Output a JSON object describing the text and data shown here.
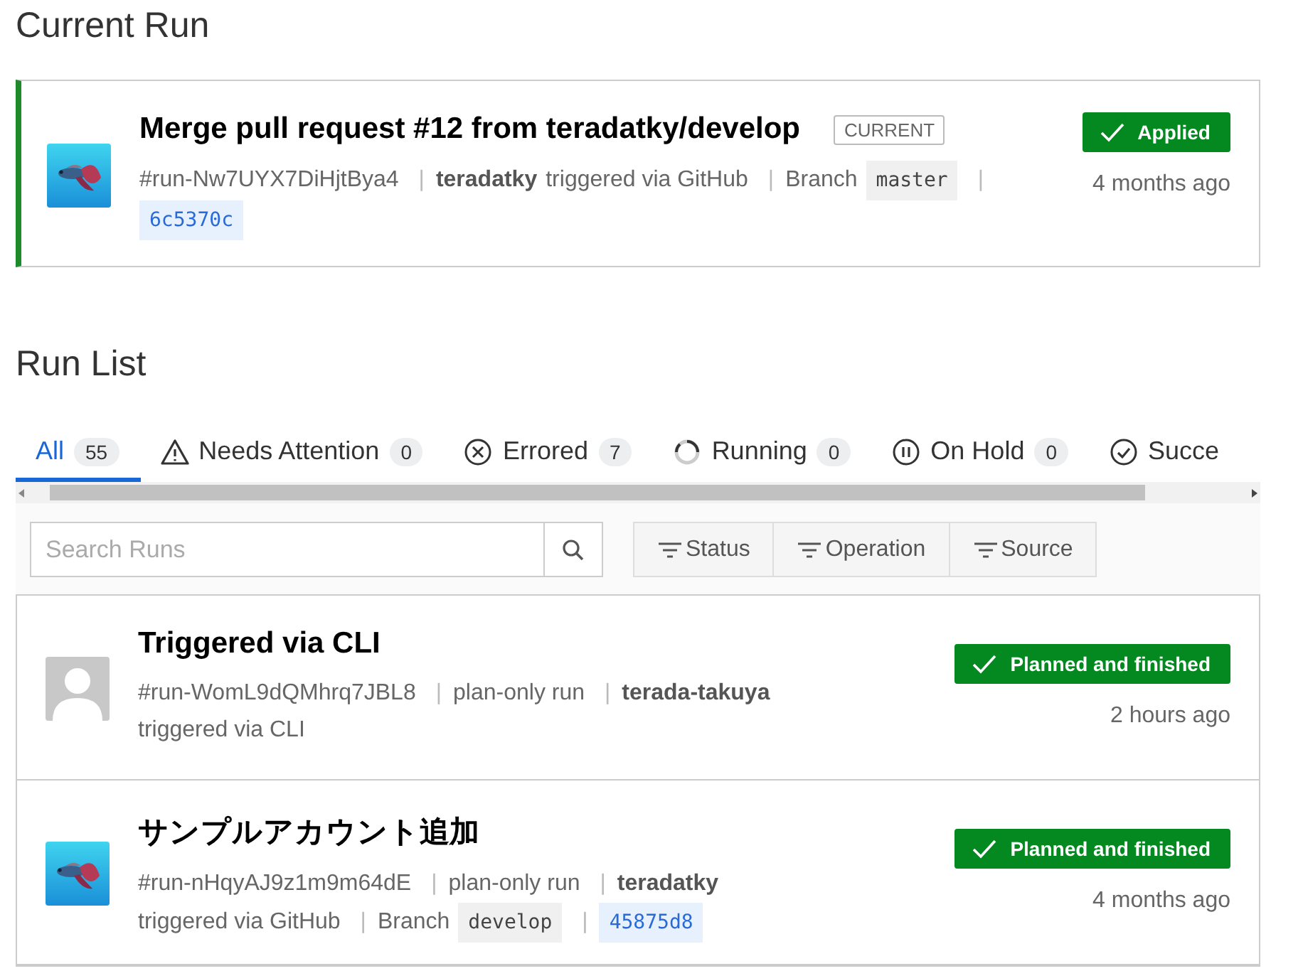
{
  "current_section": {
    "heading": "Current Run"
  },
  "current_run": {
    "title": "Merge pull request #12 from teradatky/develop",
    "tag": "CURRENT",
    "kind": "picture",
    "status": "Applied",
    "time": "4 months ago",
    "meta": [
      {
        "kind": "id",
        "text": "#run-Nw7UYX7DiHjtBya4"
      },
      {
        "kind": "sep",
        "text": "|"
      },
      {
        "kind": "user",
        "text": "teradatky"
      },
      {
        "kind": "text",
        "text": "triggered via GitHub"
      },
      {
        "kind": "sep",
        "text": "|"
      },
      {
        "kind": "text",
        "text": "Branch"
      },
      {
        "kind": "branch",
        "text": "master"
      },
      {
        "kind": "sep",
        "text": "|"
      },
      {
        "kind": "commit",
        "text": "6c5370c"
      }
    ]
  },
  "run_list_section": {
    "heading": "Run List"
  },
  "tabs": [
    {
      "label": "All",
      "count": "55",
      "kind": "plain",
      "selected": true
    },
    {
      "label": "Needs Attention",
      "count": "0",
      "kind": "warning",
      "selected": false
    },
    {
      "label": "Errored",
      "count": "7",
      "kind": "error",
      "selected": false
    },
    {
      "label": "Running",
      "count": "0",
      "kind": "running",
      "selected": false
    },
    {
      "label": "On Hold",
      "count": "0",
      "kind": "pause",
      "selected": false
    },
    {
      "label": "Succe",
      "kind": "check",
      "selected": false
    }
  ],
  "search": {
    "placeholder": "Search Runs"
  },
  "filters": [
    "Status",
    "Operation",
    "Source"
  ],
  "runs": [
    {
      "title": "Triggered via CLI",
      "kind": "default",
      "status": "Planned and finished",
      "time": "2 hours ago",
      "meta": [
        {
          "kind": "id",
          "text": "#run-WomL9dQMhrq7JBL8"
        },
        {
          "kind": "sep",
          "text": "|"
        },
        {
          "kind": "text",
          "text": "plan-only run"
        },
        {
          "kind": "sep",
          "text": "|"
        },
        {
          "kind": "user",
          "text": "terada-takuya"
        },
        {
          "kind": "text",
          "text": "triggered via CLI"
        }
      ]
    },
    {
      "title": "サンプルアカウント追加",
      "kind": "picture",
      "status": "Planned and finished",
      "time": "4 months ago",
      "meta": [
        {
          "kind": "id",
          "text": "#run-nHqyAJ9z1m9m64dE"
        },
        {
          "kind": "sep",
          "text": "|"
        },
        {
          "kind": "text",
          "text": "plan-only run"
        },
        {
          "kind": "sep",
          "text": "|"
        },
        {
          "kind": "user",
          "text": "teradatky"
        },
        {
          "kind": "text",
          "text": "triggered via GitHub"
        },
        {
          "kind": "sep",
          "text": "|"
        },
        {
          "kind": "text",
          "text": "Branch"
        },
        {
          "kind": "branch",
          "text": "develop"
        },
        {
          "kind": "sep",
          "text": "|"
        },
        {
          "kind": "commit",
          "text": "45875d8"
        }
      ]
    }
  ]
}
